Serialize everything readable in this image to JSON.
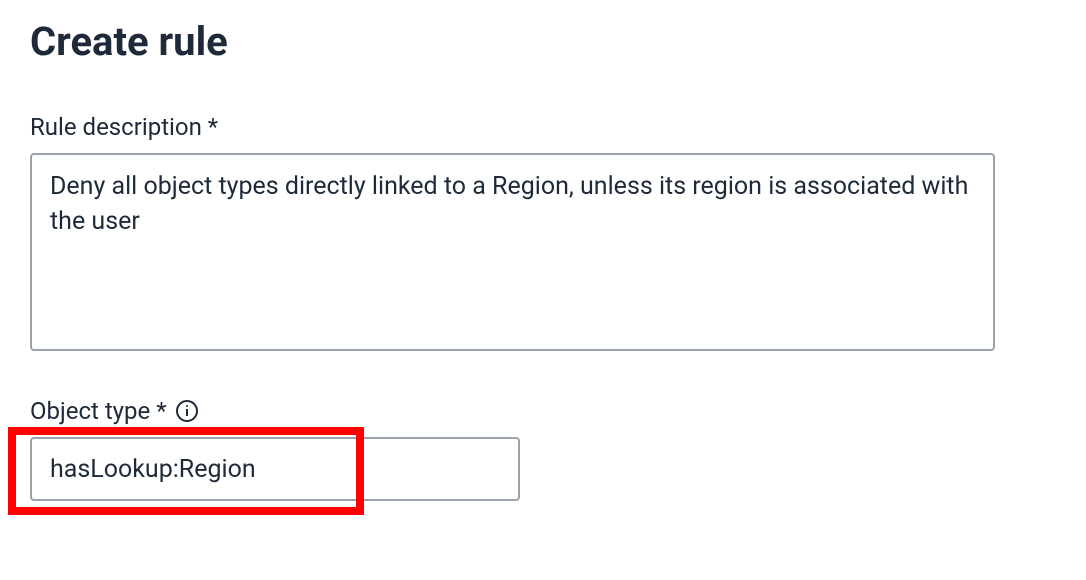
{
  "page": {
    "title": "Create rule"
  },
  "fields": {
    "ruleDescription": {
      "label": "Rule description *",
      "value": "Deny all object types directly linked to a Region, unless its region is associated with the user"
    },
    "objectType": {
      "label": "Object type *",
      "value": "hasLookup:Region"
    }
  }
}
